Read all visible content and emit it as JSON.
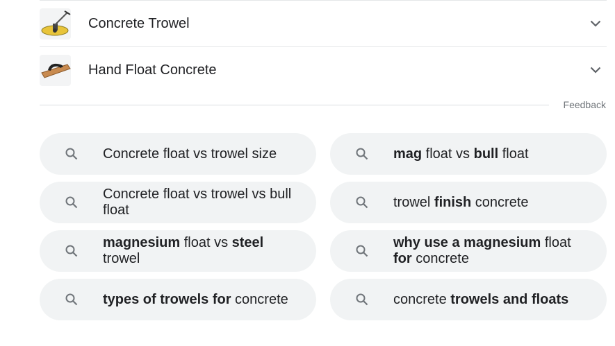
{
  "people_also_search": [
    {
      "label": "Concrete Trowel",
      "icon": "power-trowel-thumbnail"
    },
    {
      "label": "Hand Float Concrete",
      "icon": "hand-float-thumbnail"
    }
  ],
  "feedback_label": "Feedback",
  "related_searches": [
    {
      "parts": [
        {
          "text": "Concrete float vs trowel size",
          "bold": false
        }
      ]
    },
    {
      "parts": [
        {
          "text": "mag",
          "bold": true
        },
        {
          "text": " float vs ",
          "bold": false
        },
        {
          "text": "bull",
          "bold": true
        },
        {
          "text": " float",
          "bold": false
        }
      ]
    },
    {
      "parts": [
        {
          "text": "Concrete float vs trowel vs bull float",
          "bold": false
        }
      ]
    },
    {
      "parts": [
        {
          "text": "trowel ",
          "bold": false
        },
        {
          "text": "finish",
          "bold": true
        },
        {
          "text": " concrete",
          "bold": false
        }
      ]
    },
    {
      "parts": [
        {
          "text": "magnesium",
          "bold": true
        },
        {
          "text": " float vs ",
          "bold": false
        },
        {
          "text": "steel",
          "bold": true
        },
        {
          "text": " trowel",
          "bold": false
        }
      ]
    },
    {
      "parts": [
        {
          "text": "why use a magnesium",
          "bold": true
        },
        {
          "text": " float ",
          "bold": false
        },
        {
          "text": "for",
          "bold": true
        },
        {
          "text": " concrete",
          "bold": false
        }
      ]
    },
    {
      "parts": [
        {
          "text": "types of trowels for",
          "bold": true
        },
        {
          "text": " concrete",
          "bold": false
        }
      ]
    },
    {
      "parts": [
        {
          "text": "concrete ",
          "bold": false
        },
        {
          "text": "trowels and floats",
          "bold": true
        }
      ]
    }
  ],
  "icons": {
    "search": "search-icon",
    "expand": "chevron-down-icon"
  },
  "colors": {
    "chip_bg": "#f1f3f4",
    "text": "#202124",
    "muted": "#70757a",
    "divider": "#dadce0"
  }
}
